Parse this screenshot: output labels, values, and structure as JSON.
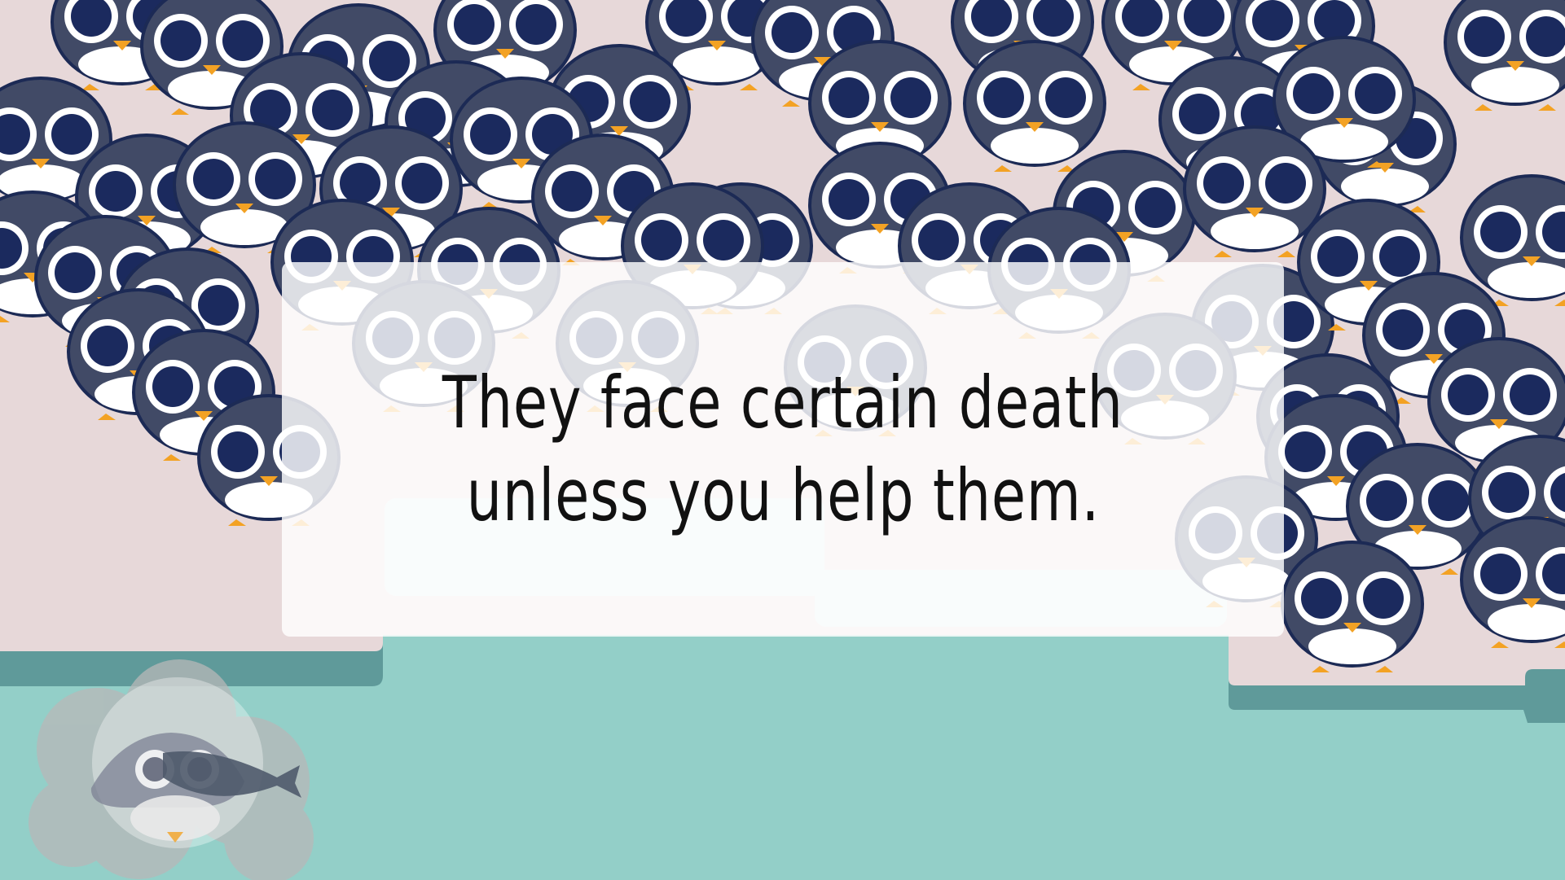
{
  "scene": {
    "caption_lines": [
      "They face certain death",
      "unless you help them."
    ],
    "palette": {
      "ice": "#e7d8d9",
      "ice_edge": "#5f9a9a",
      "water": "#93cfc8",
      "penguin_body": "#414a66",
      "penguin_outline": "#1c2a55",
      "penguin_belly": "#ffffff",
      "penguin_eye": "#1b2a5e",
      "beak": "#f3a224"
    },
    "characters": [
      "penguin-crowd",
      "swimming-penguin-with-fish",
      "bubble"
    ]
  }
}
